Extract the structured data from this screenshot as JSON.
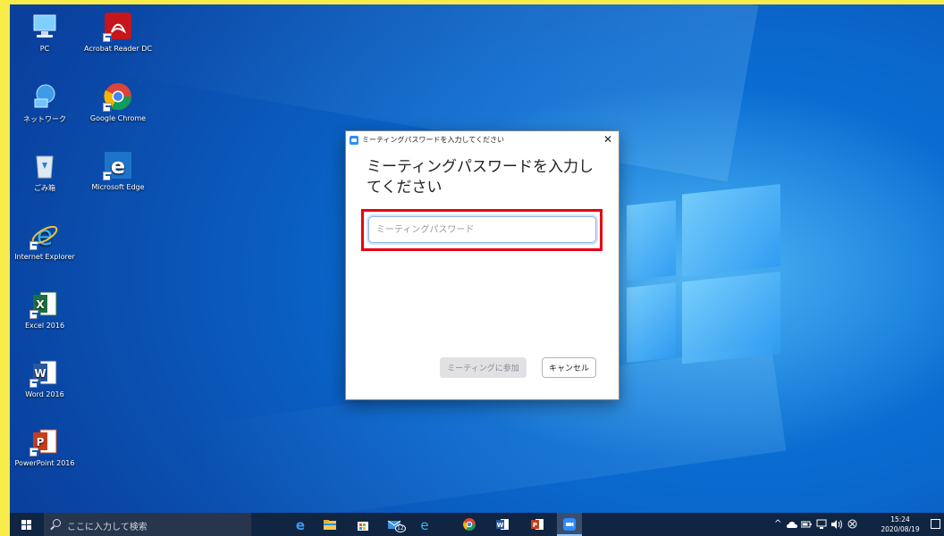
{
  "desktop": {
    "icons": [
      {
        "label": "PC"
      },
      {
        "label": "Acrobat Reader DC"
      },
      {
        "label": "ネットワーク"
      },
      {
        "label": "Google Chrome"
      },
      {
        "label": "ごみ箱"
      },
      {
        "label": "Microsoft Edge"
      },
      {
        "label": "Internet Explorer"
      },
      {
        "label": "Excel 2016"
      },
      {
        "label": "Word 2016"
      },
      {
        "label": "PowerPoint 2016"
      }
    ]
  },
  "dialog": {
    "title": "ミーティングパスワードを入力してください",
    "heading": "ミーティングパスワードを入力してください",
    "close_glyph": "✕",
    "password_placeholder": "ミーティングパスワード",
    "password_value": "",
    "join_label": "ミーティングに参加",
    "cancel_label": "キャンセル",
    "accent_color": "#2d8cff",
    "highlight_color": "#e60012"
  },
  "taskbar": {
    "search_placeholder": "ここに入力して検索",
    "mail_badge": "12",
    "tray_chevron": "^",
    "clock_time": "15:24",
    "clock_date": "2020/08/19"
  }
}
